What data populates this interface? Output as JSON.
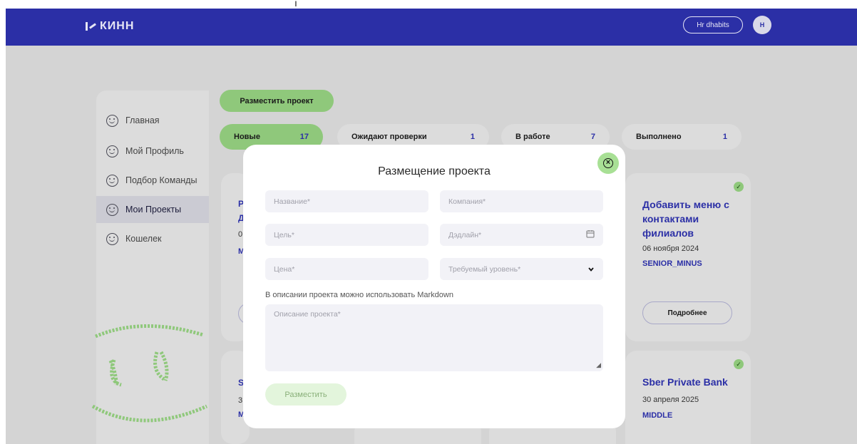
{
  "header": {
    "logo_text": "КИНН",
    "user_name": "Hr dhabits",
    "avatar_initial": "H"
  },
  "sidebar": {
    "items": [
      {
        "label": "Главная",
        "icon": "smile-icon",
        "active": false
      },
      {
        "label": "Мой Профиль",
        "icon": "smile-icon",
        "active": false
      },
      {
        "label": "Подбор Команды",
        "icon": "smile-icon",
        "active": false
      },
      {
        "label": "Мои Проекты",
        "icon": "smile-icon",
        "active": true
      },
      {
        "label": "Кошелек",
        "icon": "smile-icon",
        "active": false
      }
    ]
  },
  "main": {
    "place_project_label": "Разместить проект",
    "tabs": [
      {
        "label": "Новые",
        "count": "17",
        "active": true
      },
      {
        "label": "Ожидают проверки",
        "count": "1",
        "active": false
      },
      {
        "label": "В работе",
        "count": "7",
        "active": false
      },
      {
        "label": "Выполнено",
        "count": "1",
        "active": false
      }
    ],
    "cards": [
      {
        "title": "Добавить меню с контактами филиалов",
        "title_lines": [
          "Добавить меню с",
          "контактами",
          "филиалов"
        ],
        "date": "06 ноября 2024",
        "level": "SENIOR_MINUS",
        "details_label": "Подробнее"
      },
      {
        "title": "Sber Private Bank",
        "date": "30 апреля 2025",
        "level": "MIDDLE"
      }
    ],
    "partial_cards": [
      {
        "fragment_lines": [
          "Р",
          "Д",
          "0",
          "M"
        ]
      },
      {
        "fragment_lines": [
          "S",
          "3",
          "M"
        ]
      }
    ]
  },
  "modal": {
    "title": "Размещение проекта",
    "fields": {
      "name_placeholder": "Название*",
      "company_placeholder": "Компания*",
      "goal_placeholder": "Цель*",
      "deadline_placeholder": "Дэдлайн*",
      "price_placeholder": "Цена*",
      "level_placeholder": "Требуемый уровень*"
    },
    "markdown_hint": "В описании проекта можно использовать Markdown",
    "description_placeholder": "Описание проекта*",
    "submit_label": "Разместить"
  },
  "colors": {
    "brand": "#2b2fa6",
    "accent_green": "#8fc87b",
    "overlay": "#d4d4d4"
  }
}
